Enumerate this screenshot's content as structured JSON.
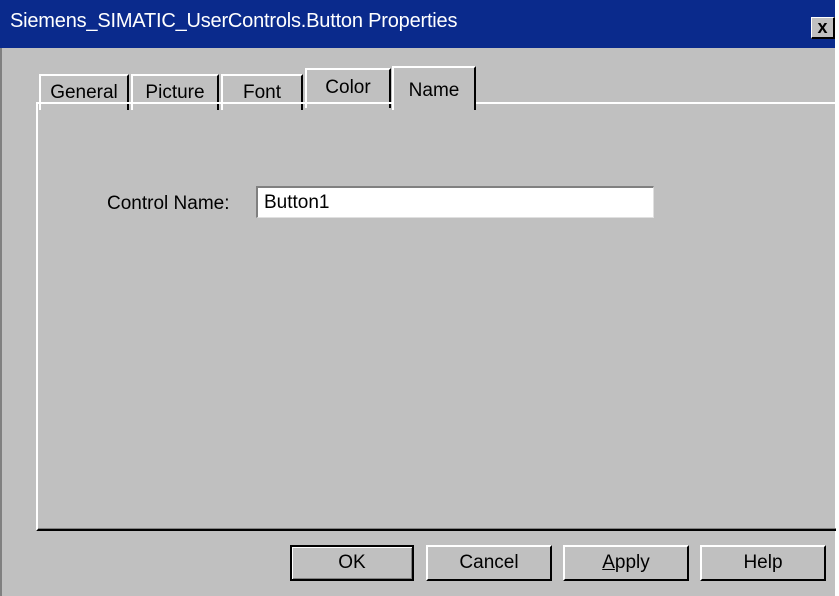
{
  "window": {
    "title": "Siemens_SIMATIC_UserControls.Button  Properties",
    "close_label": "x"
  },
  "tabs": [
    {
      "label": "General",
      "active": false
    },
    {
      "label": "Picture",
      "active": false
    },
    {
      "label": "Font",
      "active": false
    },
    {
      "label": "Color",
      "active": false
    },
    {
      "label": "Name",
      "active": true
    }
  ],
  "name_page": {
    "control_name_label": "Control Name:",
    "control_name_value": "Button1"
  },
  "buttons": {
    "ok": "OK",
    "cancel": "Cancel",
    "apply_accel": "A",
    "apply_rest": "pply",
    "help": "Help"
  },
  "colors": {
    "titlebar": "#0a2a8c",
    "face": "#c0c0c0"
  }
}
